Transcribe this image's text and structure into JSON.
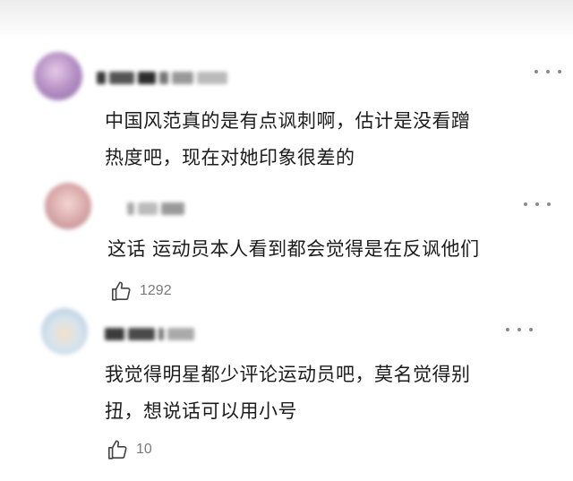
{
  "comments": [
    {
      "text_lines": [
        "中国风范真的是有点讽刺啊，估计是没看蹭",
        "热度吧，现在对她印象很差的"
      ],
      "avatar_color": "#b79ac9"
    },
    {
      "text_lines": [
        "这话 运动员本人看到都会觉得是在反讽他们"
      ],
      "like_count": "1292",
      "avatar_color": "#e3b8b6"
    },
    {
      "text_lines": [
        "我觉得明星都少评论运动员吧，莫名觉得别",
        "扭，想说话可以用小号"
      ],
      "like_count": "10",
      "avatar_color": "#c9dbe8"
    }
  ],
  "icons": {
    "more": "more-dots-icon",
    "like": "thumbs-up-icon"
  }
}
